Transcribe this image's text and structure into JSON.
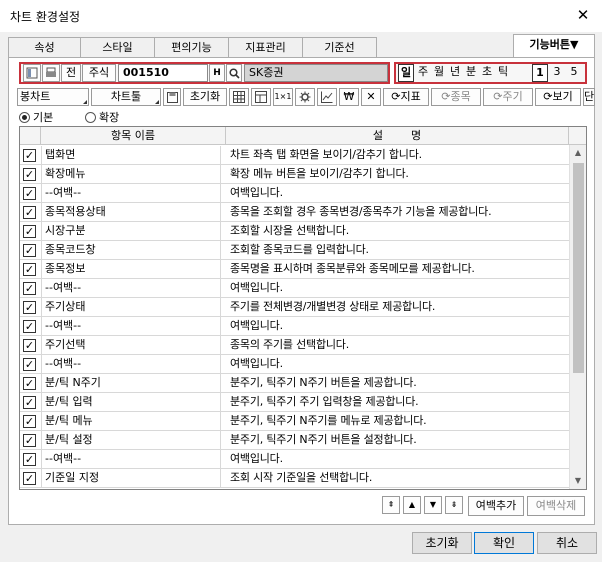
{
  "window": {
    "title": "차트 환경설정",
    "close": "✕"
  },
  "tabs": [
    {
      "label": "속성"
    },
    {
      "label": "스타일"
    },
    {
      "label": "편의기능"
    },
    {
      "label": "지표관리"
    },
    {
      "label": "기준선"
    },
    {
      "label": "기능버튼▼",
      "active": true
    }
  ],
  "toolbar1": {
    "jeon": "전",
    "jusik": "주식",
    "code": "001510",
    "h_btn": "H",
    "search_icon": "search-icon",
    "stock_name": "SK증권",
    "periods": [
      "일",
      "주",
      "월",
      "년",
      "분",
      "초",
      "틱"
    ],
    "numbers": [
      "1",
      "3",
      "5"
    ]
  },
  "toolbar2": {
    "bongchart": "봉차트",
    "charttool": "차트툴",
    "reset": "초기화",
    "cross": "✕",
    "indicator": "지표",
    "jongmok": "종목",
    "jugi": "주기",
    "view": "보기",
    "more": "단"
  },
  "radios": {
    "basic": "기본",
    "extended": "확장",
    "selected": "basic"
  },
  "grid": {
    "col_name": "항목 이름",
    "col_desc": "설        명",
    "rows": [
      {
        "checked": true,
        "name": "탭화면",
        "desc": "차트 좌측 탭 화면을 보이기/감추기 합니다."
      },
      {
        "checked": true,
        "name": "확장메뉴",
        "desc": "확장 메뉴 버튼을 보이기/감추기 합니다."
      },
      {
        "checked": true,
        "name": "--여백--",
        "desc": "여백입니다."
      },
      {
        "checked": true,
        "name": "종목적용상태",
        "desc": "종목을 조회할 경우 종목변경/종목추가 기능을 제공합니다."
      },
      {
        "checked": true,
        "name": "시장구분",
        "desc": "조회할 시장을 선택합니다."
      },
      {
        "checked": true,
        "name": "종목코드창",
        "desc": "조회할 종목코드를 입력합니다."
      },
      {
        "checked": true,
        "name": "종목정보",
        "desc": "종목명을 표시하며 종목분류와 종목메모를 제공합니다."
      },
      {
        "checked": true,
        "name": "--여백--",
        "desc": "여백입니다."
      },
      {
        "checked": true,
        "name": "주기상태",
        "desc": "주기를 전체변경/개별변경 상태로 제공합니다."
      },
      {
        "checked": true,
        "name": "--여백--",
        "desc": "여백입니다."
      },
      {
        "checked": true,
        "name": "주기선택",
        "desc": "종목의 주기를 선택합니다."
      },
      {
        "checked": true,
        "name": "--여백--",
        "desc": "여백입니다."
      },
      {
        "checked": true,
        "name": "분/틱 N주기",
        "desc": "분주기, 틱주기 N주기 버튼을 제공합니다."
      },
      {
        "checked": true,
        "name": "분/틱 입력",
        "desc": "분주기, 틱주기 주기 입력창을 제공합니다."
      },
      {
        "checked": true,
        "name": "분/틱 메뉴",
        "desc": "분주기, 틱주기 N주기를 메뉴로 제공합니다."
      },
      {
        "checked": true,
        "name": "분/틱 설정",
        "desc": "분주기, 틱주기 N주기 버튼을 설정합니다."
      },
      {
        "checked": true,
        "name": "--여백--",
        "desc": "여백입니다."
      },
      {
        "checked": true,
        "name": "기준일 지정",
        "desc": "조회 시작 기준일을 선택합니다."
      }
    ]
  },
  "bottom": {
    "add_blank": "여백추가",
    "del_blank": "여백삭제"
  },
  "footer": {
    "reset": "초기화",
    "ok": "확인",
    "cancel": "취소"
  }
}
